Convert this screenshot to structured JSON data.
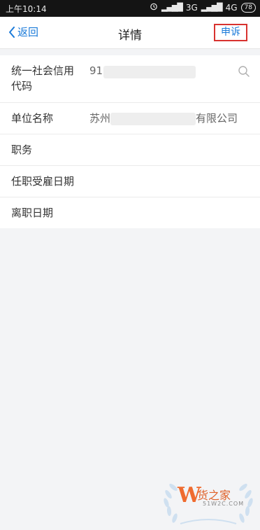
{
  "status_bar": {
    "time": "上午10:14",
    "network": "3G",
    "network2": "4G",
    "battery": "78"
  },
  "nav": {
    "back_label": "返回",
    "title": "详情",
    "appeal_label": "申诉"
  },
  "details": {
    "rows": [
      {
        "label": "统一社会信用代码",
        "value": "91"
      },
      {
        "label": "单位名称",
        "value": "苏州",
        "value_suffix": "有限公司"
      },
      {
        "label": "职务",
        "value": ""
      },
      {
        "label": "任职受雇日期",
        "value": ""
      },
      {
        "label": "离职日期",
        "value": ""
      }
    ]
  },
  "watermark": {
    "name": "货之家",
    "domain": "51W2C.COM"
  },
  "colors": {
    "accent": "#1a7ad9",
    "highlight_border": "#d8322f",
    "background": "#f3f4f6"
  },
  "icons": [
    "chevron-left-icon",
    "search-icon",
    "alarm-icon",
    "signal-icon",
    "battery-icon"
  ]
}
